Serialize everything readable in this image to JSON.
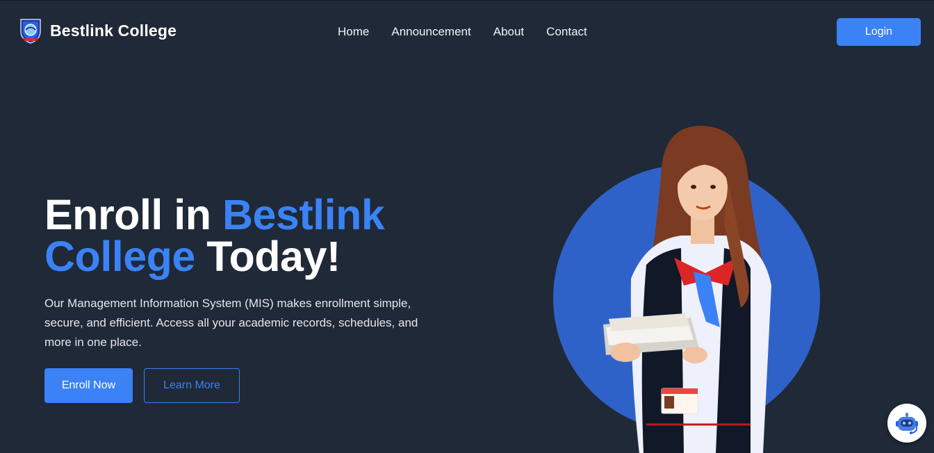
{
  "header": {
    "brand_name": "Bestlink College",
    "brand_logo_icon": "college-shield-logo",
    "nav": [
      {
        "label": "Home"
      },
      {
        "label": "Announcement"
      },
      {
        "label": "About"
      },
      {
        "label": "Contact"
      }
    ],
    "login_label": "Login"
  },
  "hero": {
    "title_part1": "Enroll in ",
    "title_accent": "Bestlink College",
    "title_part2": " Today!",
    "description": "Our Management Information System (MIS) makes enrollment simple, secure, and efficient. Access all your academic records, schedules, and more in one place.",
    "enroll_label": "Enroll Now",
    "learn_more_label": "Learn More",
    "illustration_icon": "student-with-books-image"
  },
  "chatbot": {
    "icon": "chatbot-robot-icon"
  },
  "colors": {
    "background": "#1f2937",
    "accent": "#3b82f6",
    "circle": "#2f62c9"
  }
}
